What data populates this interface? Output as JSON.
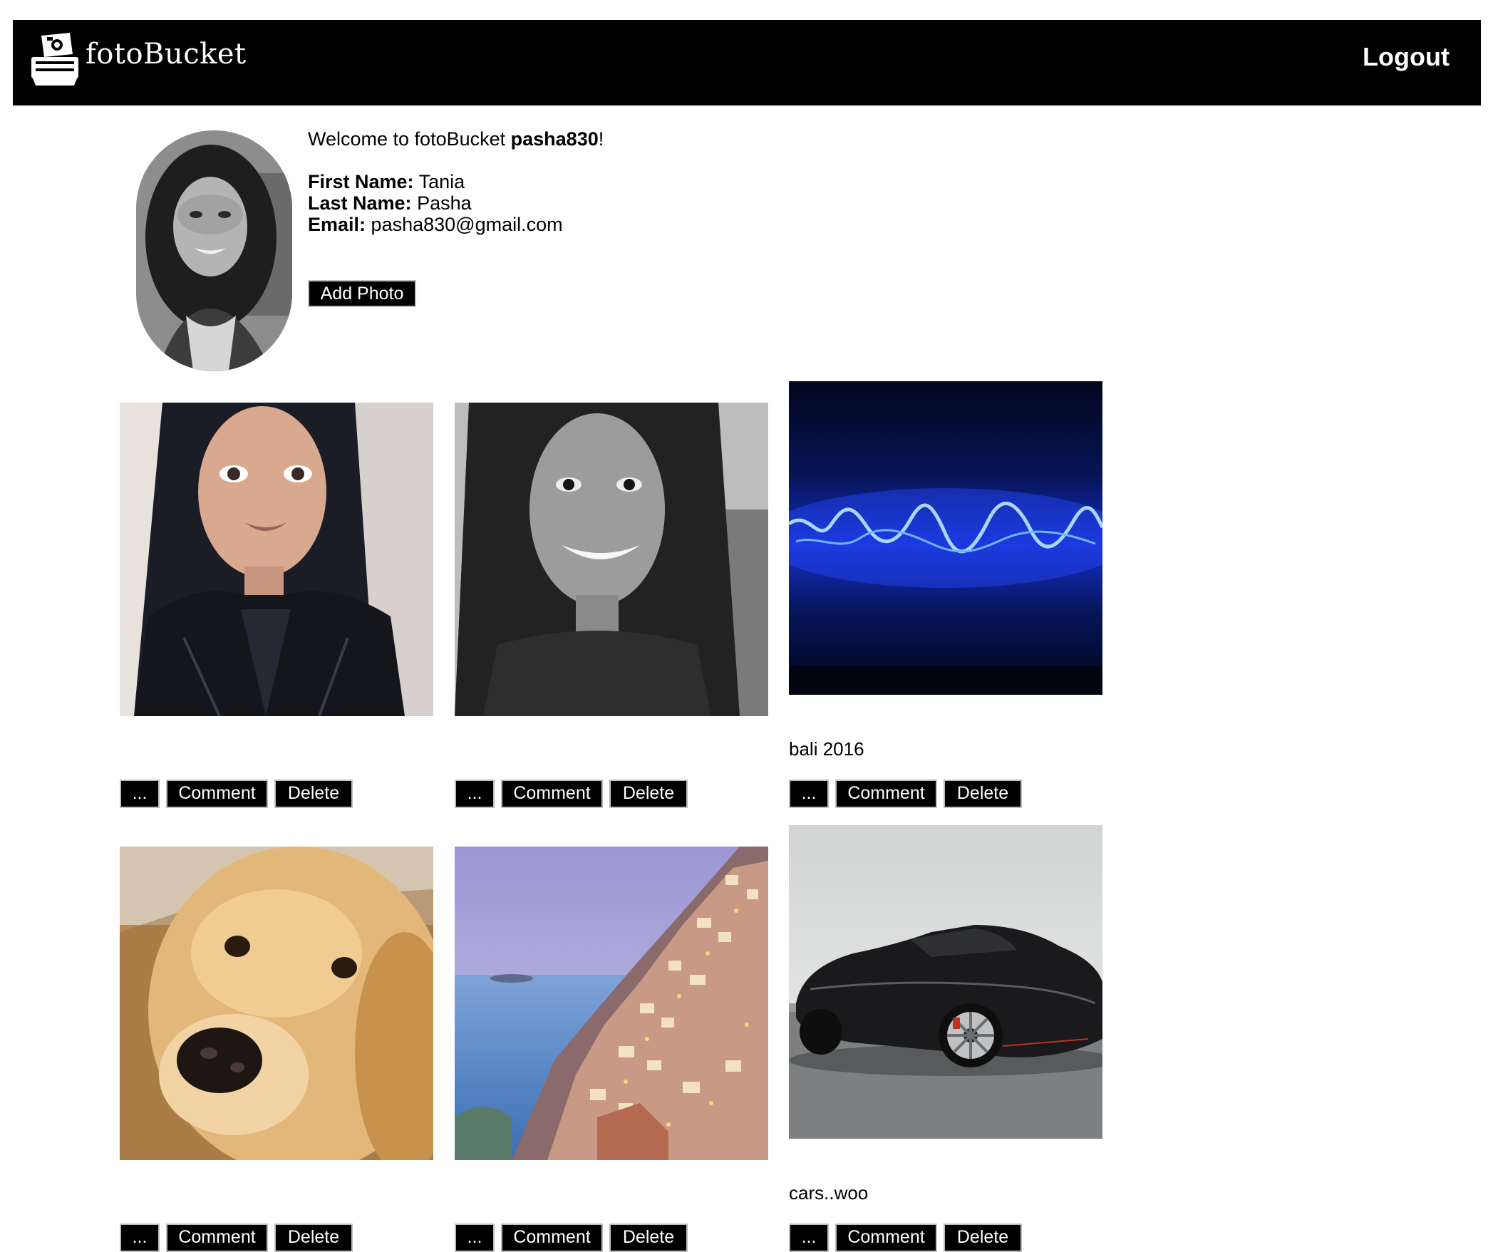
{
  "nav": {
    "brand": "fotoBucket",
    "logout_label": "Logout",
    "logo_icon": "polaroid-camera-icon"
  },
  "profile": {
    "welcome_prefix": "Welcome to fotoBucket ",
    "username": "pasha830",
    "welcome_suffix": "!",
    "first_name_label": "First Name:",
    "first_name": "Tania",
    "last_name_label": "Last Name:",
    "last_name": "Pasha",
    "email_label": "Email:",
    "email": "pasha830@gmail.com",
    "add_photo_label": "Add Photo"
  },
  "photo_actions": {
    "more_label": "...",
    "comment_label": "Comment",
    "delete_label": "Delete"
  },
  "photos": [
    {
      "subject": "selfie-woman-leather-jacket",
      "caption": ""
    },
    {
      "subject": "selfie-woman-black-and-white",
      "caption": ""
    },
    {
      "subject": "blue-neon-text",
      "caption": "bali 2016"
    },
    {
      "subject": "golden-retriever",
      "caption": ""
    },
    {
      "subject": "coastal-cliff-town",
      "caption": ""
    },
    {
      "subject": "black-sports-car",
      "caption": "cars..woo"
    }
  ]
}
